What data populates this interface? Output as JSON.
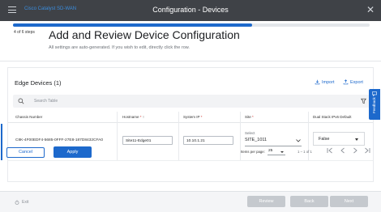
{
  "app": {
    "name": "Cisco Catalyst SD-WAN",
    "window_title": "Configuration - Devices"
  },
  "progress": {
    "steps_text": "4 of 6 steps",
    "fraction": 0.67
  },
  "page": {
    "heading": "Add and Review Device Configuration",
    "subheading": "All settings are auto-generated. If you wish to edit, directly click the row."
  },
  "card": {
    "title": "Edge Devices (1)",
    "import_label": "Import",
    "export_label": "Export",
    "search_placeholder": "Search Table"
  },
  "table": {
    "columns": [
      {
        "label": "Chassis Number",
        "required": false,
        "sort": ""
      },
      {
        "label": "Hostname",
        "required": true,
        "sort": "↑"
      },
      {
        "label": "System IP",
        "required": true,
        "sort": ""
      },
      {
        "label": "Site",
        "required": true,
        "sort": ""
      },
      {
        "label": "Dual Stack IPv6 Default",
        "required": false,
        "sort": ""
      }
    ],
    "rows": [
      {
        "chassis": "C8K-4F00EDF4-5685-0FFF-27E8-187D8432CFA0",
        "hostname": "Site11-Edge01",
        "system_ip": "10.10.1.21",
        "site_label": "Select",
        "site_value": "SITE_1011",
        "dual_stack": "False"
      }
    ]
  },
  "actions": {
    "cancel": "Cancel",
    "apply": "Apply"
  },
  "pagination": {
    "items_per_page_label": "Items per page:",
    "items_per_page": "25",
    "range": "1 – 1 of 1"
  },
  "feedback_tab": "Feedback",
  "footer": {
    "exit": "Exit",
    "review": "Review",
    "back": "Back",
    "next": "Next"
  },
  "colors": {
    "accent": "#1d69cc",
    "topbar": "#3f4247",
    "disabled": "#c5c9ce",
    "required": "#d0342c"
  },
  "icons": [
    "menu-icon",
    "close-icon",
    "import-icon",
    "export-icon",
    "search-icon",
    "filter-icon",
    "chevron-down-icon",
    "first-page-icon",
    "prev-page-icon",
    "next-page-icon",
    "last-page-icon",
    "feedback-icon",
    "exit-icon"
  ]
}
